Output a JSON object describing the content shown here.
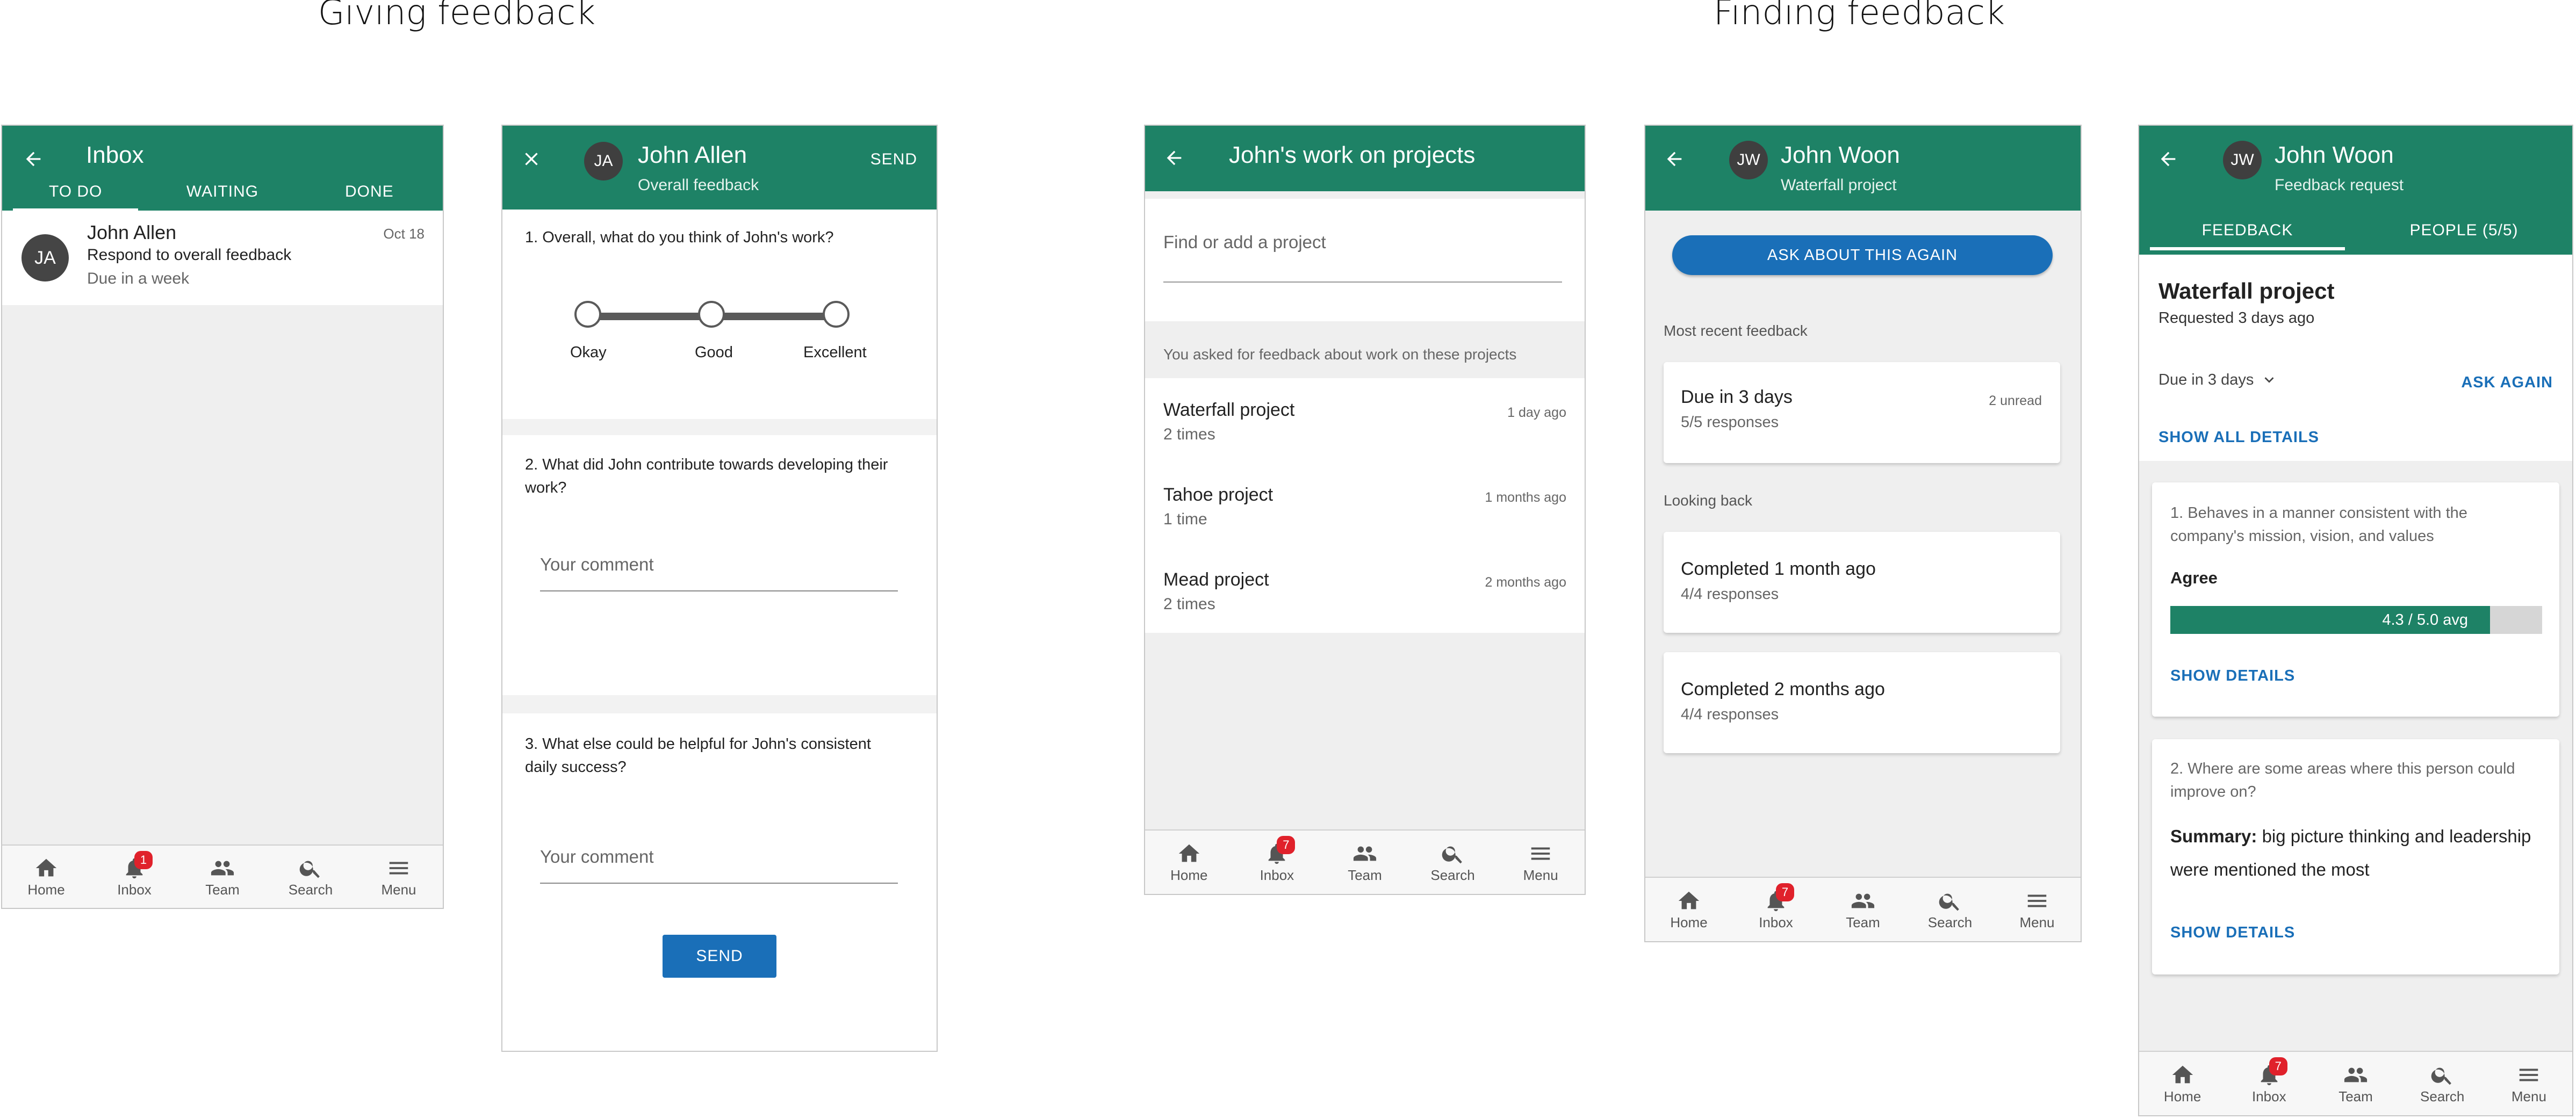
{
  "sections": {
    "giving": "Giving feedback",
    "finding": "Finding feedback"
  },
  "colors": {
    "appbar": "#1e8266",
    "accent_blue": "#1a6fb8",
    "badge_red": "#e0212b",
    "progress": "#1e8266"
  },
  "nav": {
    "home": "Home",
    "inbox": "Inbox",
    "team": "Team",
    "search": "Search",
    "menu": "Menu"
  },
  "screen1": {
    "title": "Inbox",
    "tabs": [
      "TO DO",
      "WAITING",
      "DONE"
    ],
    "badge": "1",
    "item": {
      "avatar": "JA",
      "name": "John Allen",
      "date": "Oct 18",
      "line1": "Respond to overall feedback",
      "line2": "Due in a week"
    }
  },
  "screen2": {
    "avatar": "JA",
    "name": "John Allen",
    "subtitle": "Overall feedback",
    "send_top": "SEND",
    "q1": "1. Overall, what do you think of John's work?",
    "slider_labels": [
      "Okay",
      "Good",
      "Excellent"
    ],
    "q2": "2. What did John contribute towards developing their work?",
    "q3": "3. What else could be helpful for John's consistent daily success?",
    "comment_placeholder": "Your comment",
    "send_button": "SEND"
  },
  "screen3": {
    "title": "John's work on projects",
    "search_placeholder": "Find or add a project",
    "section_header": "You asked for feedback about work on these projects",
    "badge": "7",
    "projects": [
      {
        "name": "Waterfall project",
        "count": "2 times",
        "when": "1 day ago"
      },
      {
        "name": "Tahoe project",
        "count": "1 time",
        "when": "1 months ago"
      },
      {
        "name": "Mead project",
        "count": "2 times",
        "when": "2 months ago"
      }
    ]
  },
  "screen4": {
    "avatar": "JW",
    "name": "John Woon",
    "subtitle": "Waterfall project",
    "ask_button": "ASK ABOUT THIS AGAIN",
    "recent_label": "Most recent feedback",
    "recent_card": {
      "title": "Due in 3 days",
      "sub": "5/5 responses",
      "meta": "2 unread"
    },
    "looking_back_label": "Looking back",
    "back_cards": [
      {
        "title": "Completed 1 month ago",
        "sub": "4/4 responses"
      },
      {
        "title": "Completed 2 months ago",
        "sub": "4/4 responses"
      }
    ],
    "badge": "7"
  },
  "screen5": {
    "avatar": "JW",
    "name": "John Woon",
    "subtitle": "Feedback request",
    "tabs": [
      "FEEDBACK",
      "PEOPLE (5/5)"
    ],
    "project_title": "Waterfall project",
    "requested": "Requested 3 days ago",
    "due": "Due in 3 days",
    "ask_again": "ASK AGAIN",
    "show_all": "SHOW ALL DETAILS",
    "card1": {
      "question": "1. Behaves in a manner consistent with the company's mission, vision, and values",
      "answer": "Agree",
      "progress_label": "4.3 / 5.0 avg",
      "progress_fraction": 0.86,
      "show_details": "SHOW DETAILS"
    },
    "card2": {
      "question": "2. Where are some areas where this person could improve on?",
      "summary_label": "Summary:",
      "summary_text": "big picture thinking and leadership were mentioned the most",
      "show_details": "SHOW DETAILS"
    },
    "badge": "7"
  }
}
